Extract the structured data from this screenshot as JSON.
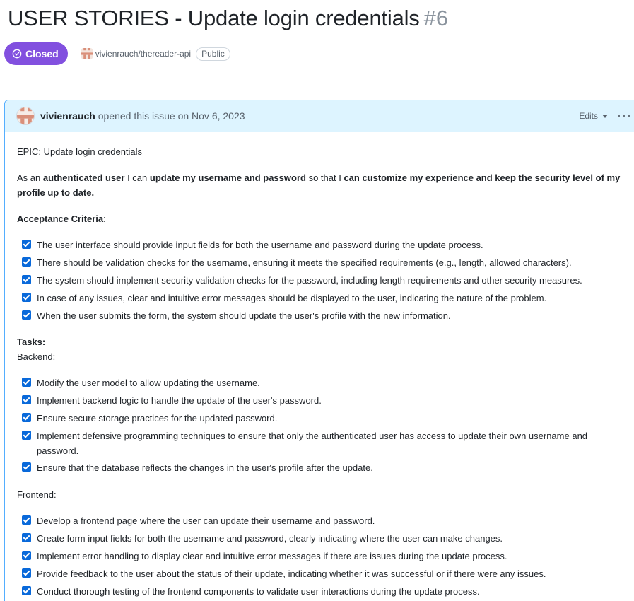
{
  "issue": {
    "title": "USER STORIES - Update login credentials",
    "number": "#6",
    "state": "Closed",
    "repo": "vivienrauch/thereader-api",
    "visibility": "Public"
  },
  "comment": {
    "author": "vivienrauch",
    "action_text": " opened this issue on Nov 6, 2023",
    "edits_label": "Edits",
    "menu_glyph": "···"
  },
  "body": {
    "epic": "EPIC: Update login credentials",
    "story": {
      "t1": "As an ",
      "b1": "authenticated user",
      "t2": " I can ",
      "b2": "update my username and password",
      "t3": " so that I ",
      "b3": "can customize my experience and keep the security level of my profile up to date."
    },
    "acceptance_heading": "Acceptance Criteria",
    "acceptance_suffix": ":",
    "acceptance": [
      "The user interface should provide input fields for both the username and password during the update process.",
      "There should be validation checks for the username, ensuring it meets the specified requirements (e.g., length, allowed characters).",
      "The system should implement security validation checks for the password, including length requirements and other security measures.",
      "In case of any issues, clear and intuitive error messages should be displayed to the user, indicating the nature of the problem.",
      "When the user submits the form, the system should update the user's profile with the new information."
    ],
    "tasks_heading": "Tasks:",
    "backend_heading": "Backend:",
    "backend": [
      "Modify the user model to allow updating the username.",
      "Implement backend logic to handle the update of the user's password.",
      "Ensure secure storage practices for the updated password.",
      "Implement defensive programming techniques to ensure that only the authenticated user has access to update their own username and password.",
      "Ensure that the database reflects the changes in the user's profile after the update."
    ],
    "frontend_heading": "Frontend:",
    "frontend": [
      "Develop a frontend page where the user can update their username and password.",
      "Create form input fields for both the username and password, clearly indicating where the user can make changes.",
      "Implement error handling to display clear and intuitive error messages if there are issues during the update process.",
      "Provide feedback to the user about the status of their update, indicating whether it was successful or if there were any issues.",
      "Conduct thorough testing of the frontend components to validate user interactions during the update process."
    ]
  },
  "colors": {
    "closed_badge": "#8250df",
    "checkbox": "#0969da",
    "header_bg": "#ddf4ff",
    "header_border": "#54aeff"
  }
}
